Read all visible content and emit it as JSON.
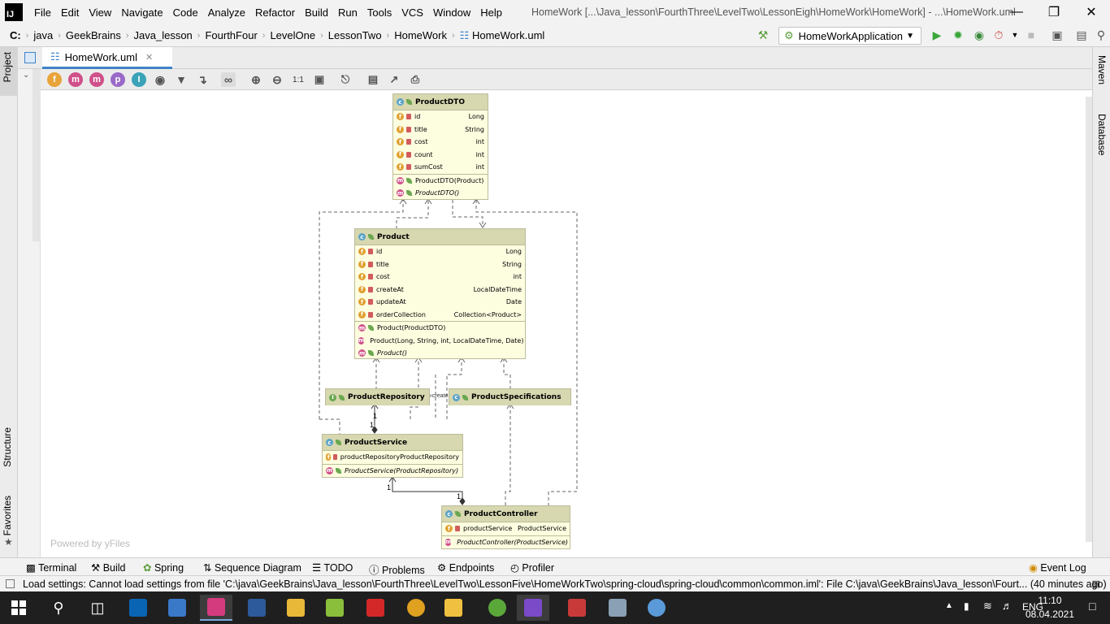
{
  "menu": {
    "logo": "IJ",
    "items": [
      "File",
      "Edit",
      "View",
      "Navigate",
      "Code",
      "Analyze",
      "Refactor",
      "Build",
      "Run",
      "Tools",
      "VCS",
      "Window",
      "Help"
    ],
    "window_title": "HomeWork [...\\Java_lesson\\FourthThree\\LevelTwo\\LessonEigh\\HomeWork\\HomeWork] - ...\\HomeWork.uml"
  },
  "breadcrumbs": [
    "C:",
    "java",
    "GeekBrains",
    "Java_lesson",
    "FourthFour",
    "LevelOne",
    "LessonTwo",
    "HomeWork",
    "HomeWork.uml"
  ],
  "run_config": "HomeWorkApplication",
  "editor": {
    "tab_label": "HomeWork.uml",
    "zoom_label": "1:1",
    "powered_by": "Powered by yFiles"
  },
  "side_tabs": {
    "left": [
      "Project",
      "Structure",
      "Favorites"
    ],
    "right": [
      "Maven",
      "Database"
    ]
  },
  "uml": {
    "product_dto": {
      "name": "ProductDTO",
      "fields": [
        [
          "id",
          "Long"
        ],
        [
          "title",
          "String"
        ],
        [
          "cost",
          "int"
        ],
        [
          "count",
          "int"
        ],
        [
          "sumCost",
          "int"
        ]
      ],
      "methods": [
        "ProductDTO(Product)",
        "ProductDTO()"
      ]
    },
    "product": {
      "name": "Product",
      "fields": [
        [
          "id",
          "Long"
        ],
        [
          "title",
          "String"
        ],
        [
          "cost",
          "int"
        ],
        [
          "createAt",
          "LocalDateTime"
        ],
        [
          "updateAt",
          "Date"
        ],
        [
          "orderCollection",
          "Collection<Product>"
        ]
      ],
      "methods": [
        "Product(ProductDTO)",
        "Product(Long, String, int, LocalDateTime, Date)",
        "Product()"
      ]
    },
    "product_repository": {
      "name": "ProductRepository"
    },
    "product_specifications": {
      "name": "ProductSpecifications"
    },
    "creates_label": "«create»",
    "product_service": {
      "name": "ProductService",
      "fields": [
        [
          "productRepository",
          "ProductRepository"
        ]
      ],
      "methods": [
        "ProductService(ProductRepository)"
      ]
    },
    "product_controller": {
      "name": "ProductController",
      "fields": [
        [
          "productService",
          "ProductService"
        ]
      ],
      "methods": [
        "ProductController(ProductService)"
      ]
    },
    "multiplicity": "1"
  },
  "bottom_tabs": [
    "Terminal",
    "Build",
    "Spring",
    "Sequence Diagram",
    "TODO",
    "Problems",
    "Endpoints",
    "Profiler",
    "Event Log"
  ],
  "status": "Load settings: Cannot load settings from file 'C:\\java\\GeekBrains\\Java_lesson\\FourthThree\\LevelTwo\\LessonFive\\HomeWorkTwo\\spring-cloud\\spring-cloud\\common\\common.iml': File C:\\java\\GeekBrains\\Java_lesson\\Fourt... (40 minutes ago)",
  "taskbar": {
    "lang": "ENG",
    "time": "11:10",
    "date": "08.04.2021"
  },
  "colors": {
    "accent": "#4083c9",
    "uml_header": "#d7d7b0",
    "uml_body": "#fdfde0",
    "taskbar": "#1f1f1f"
  }
}
